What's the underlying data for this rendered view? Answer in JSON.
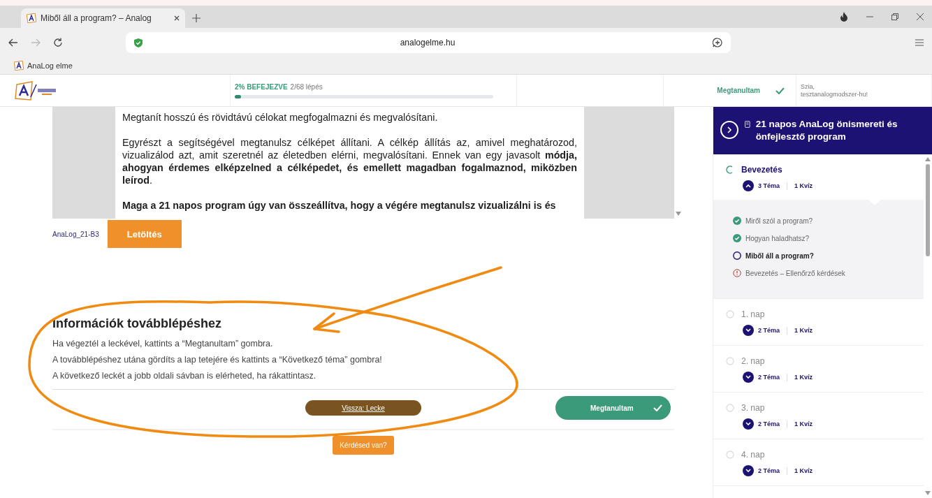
{
  "browser": {
    "tab": {
      "title": "Miből áll a program? – Analog",
      "selected": true
    },
    "url": "analogelme.hu",
    "bookmarks": [
      "AnaLog elme"
    ]
  },
  "header": {
    "progress_label": "2% BEFEJEZVE",
    "progress_steps": "2/68 lépés",
    "level": 0.02,
    "learned": "Megtanultam",
    "greeting": "Szia,\ntesztanalogmodszer-hu!"
  },
  "document": {
    "paragraphs": [
      {
        "text": "Megtanít hosszú és rövidtávú célokat megfogalmazni és megvalósítani.",
        "bold": false
      },
      {
        "text": "Egyrészt a segítségével megtanulsz célképet állítani. A célkép állítás az, amivel meghatározod, vizualizálod azt, amit szeretnél az életedben elérni, megvalósítani. Ennek van egy javasolt **módja, ahogyan érdemes elképzelned a célképedet, és emellett magadban fogalmaznod, miközben leírod**.",
        "bold": false
      },
      {
        "text": "Maga a 21 napos program úgy van összeállítva, hogy a végére megtanulsz vizualizálni is és",
        "bold": true
      }
    ],
    "file_name": "AnaLog_21-B3",
    "download": "Letöltés"
  },
  "info": {
    "title": "Információk továbblépéshez",
    "lines": [
      "Ha végeztél a leckével, kattints a “Megtanultam” gombra.",
      "A továbblépéshez utána gördíts a lap tetejére és kattints a “Következő téma” gombra!",
      "A következő leckét a jobb oldali sávban is elérheted, ha rákattintasz."
    ]
  },
  "actions": {
    "back": "Vissza: Lecke",
    "learned": "Megtanultam",
    "question": "Kérdésed van?"
  },
  "sidebar": {
    "title": "21 napos AnaLog önismereti és önfejlesztő program",
    "sections": [
      {
        "title": "Bevezetés",
        "kind": "in-progress",
        "expanded": true,
        "topics": "3 Téma",
        "quiz": "1 Kvíz",
        "lessons": [
          {
            "title": "Miről szól a program?",
            "kind": "done",
            "selected": false
          },
          {
            "title": "Hogyan haladhatsz?",
            "kind": "done",
            "selected": false
          },
          {
            "title": "Miből áll a program?",
            "kind": "current",
            "selected": true
          },
          {
            "title": "Bevezetés – Ellenőrző kérdések",
            "kind": "quiz",
            "selected": false
          }
        ]
      },
      {
        "title": "1. nap",
        "kind": "not-started",
        "expanded": false,
        "topics": "2 Téma",
        "quiz": "1 Kvíz"
      },
      {
        "title": "2. nap",
        "kind": "not-started",
        "expanded": false,
        "topics": "2 Téma",
        "quiz": "1 Kvíz"
      },
      {
        "title": "3. nap",
        "kind": "not-started",
        "expanded": false,
        "topics": "2 Téma",
        "quiz": "1 Kvíz"
      },
      {
        "title": "4. nap",
        "kind": "not-started",
        "expanded": false,
        "topics": "2 Téma",
        "quiz": "1 Kvíz"
      }
    ]
  }
}
